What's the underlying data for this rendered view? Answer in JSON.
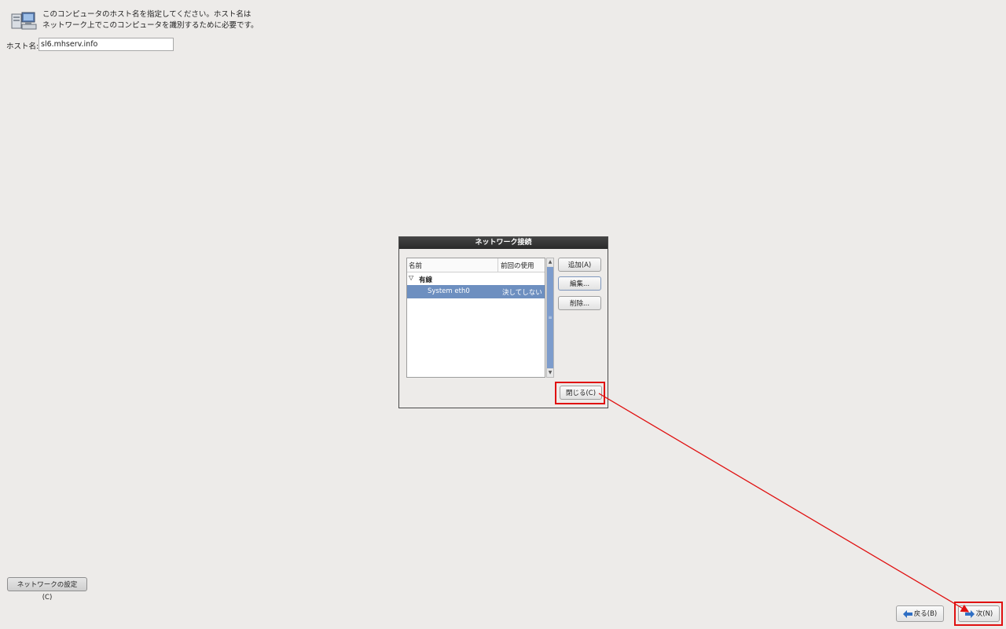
{
  "header": {
    "line1": "このコンピュータのホスト名を指定してください。ホスト名は",
    "line2": "ネットワーク上でこのコンピュータを識別するために必要です。",
    "icon": "network-computers-icon"
  },
  "hostname": {
    "label": "ホスト名:",
    "value": "sl6.mhserv.info"
  },
  "dialog": {
    "title": "ネットワーク接続",
    "columns": {
      "name": "名前",
      "last_used": "前回の使用"
    },
    "group": {
      "toggle": "▽",
      "label": "有線"
    },
    "connection": {
      "name": "System eth0",
      "last_used": "決してしない"
    },
    "buttons": {
      "add": "追加(A)",
      "edit": "編集...",
      "delete": "削除...",
      "close": "閉じる(C)"
    }
  },
  "bottom": {
    "network_settings": "ネットワークの設定(C)",
    "back": "戻る(B)",
    "next": "次(N)"
  },
  "colors": {
    "background": "#edebe9",
    "selection": "#6d8fc0",
    "annotation": "#e01010",
    "arrow_icon": "#2f6fc4"
  }
}
